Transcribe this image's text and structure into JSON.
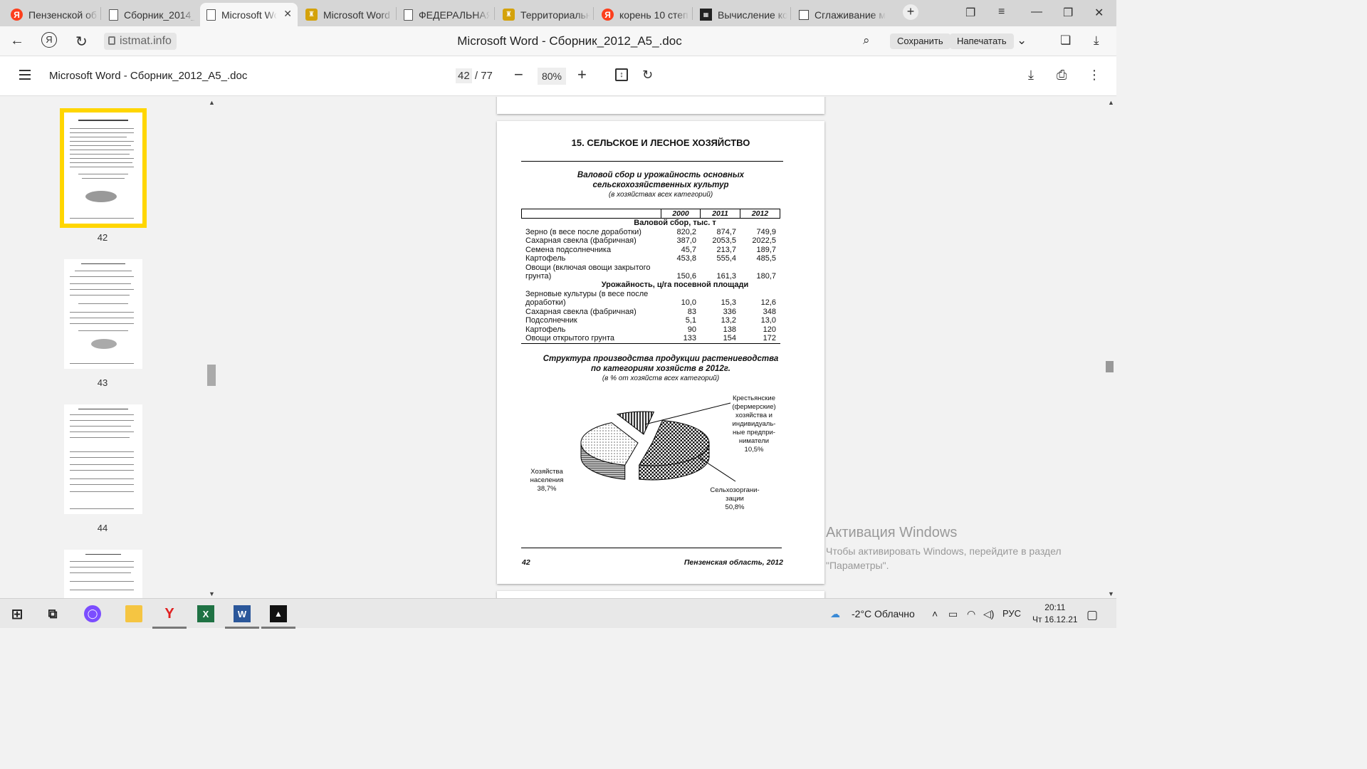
{
  "tabs": [
    {
      "label": "Пензенской об",
      "icon": "yandex-icon"
    },
    {
      "label": "Сборник_2014_",
      "icon": "document-icon"
    },
    {
      "label": "Microsoft Wo",
      "icon": "document-icon",
      "active": true
    },
    {
      "label": "Microsoft Word",
      "icon": "gerb-icon"
    },
    {
      "label": "ФЕДЕРАЛЬНАЯ",
      "icon": "document-icon"
    },
    {
      "label": "Территориальн",
      "icon": "gerb-icon"
    },
    {
      "label": "корень 10 степ",
      "icon": "yandex-icon"
    },
    {
      "label": "Вычисление ко",
      "icon": "nse-icon"
    },
    {
      "label": "Сглаживание м",
      "icon": "page-icon"
    }
  ],
  "addressbar": {
    "domain": "istmat.info",
    "page_title": "Microsoft Word - Сборник_2012_A5_.doc",
    "save_label": "Сохранить",
    "print_label": "Напечатать"
  },
  "pdf_toolbar": {
    "title": "Microsoft Word - Сборник_2012_A5_.doc",
    "current_page": "42",
    "total_pages": "/ 77",
    "zoom": "80%"
  },
  "thumbnails": [
    {
      "number": "42"
    },
    {
      "number": "43"
    },
    {
      "number": "44"
    }
  ],
  "document": {
    "section_title": "15. СЕЛЬСКОЕ И ЛЕСНОЕ ХОЗЯЙСТВО",
    "table_title_line1": "Валовой сбор и урожайность основных",
    "table_title_line2": "сельскохозяйственных культур",
    "table_subtitle": "(в хозяйствах всех категорий)",
    "years": [
      "2000",
      "2011",
      "2012"
    ],
    "section1": "Валовой сбор, тыс. т",
    "section2": "Урожайность, ц/га посевной площади",
    "rows1": [
      {
        "label": "Зерно (в весе после доработки)",
        "v": [
          "820,2",
          "874,7",
          "749,9"
        ]
      },
      {
        "label": "Сахарная свекла (фабричная)",
        "v": [
          "387,0",
          "2053,5",
          "2022,5"
        ]
      },
      {
        "label": "Семена подсолнечника",
        "v": [
          "45,7",
          "213,7",
          "189,7"
        ]
      },
      {
        "label": "Картофель",
        "v": [
          "453,8",
          "555,4",
          "485,5"
        ]
      },
      {
        "label": "Овощи (включая овощи закрытого",
        "v": [
          "",
          "",
          ""
        ]
      },
      {
        "label": "грунта)",
        "v": [
          "150,6",
          "161,3",
          "180,7"
        ]
      }
    ],
    "rows2": [
      {
        "label": "Зерновые культуры (в весе после",
        "v": [
          "",
          "",
          ""
        ]
      },
      {
        "label": "доработки)",
        "v": [
          "10,0",
          "15,3",
          "12,6"
        ]
      },
      {
        "label": "Сахарная свекла (фабричная)",
        "v": [
          "83",
          "336",
          "348"
        ]
      },
      {
        "label": "Подсолнечник",
        "v": [
          "5,1",
          "13,2",
          "13,0"
        ]
      },
      {
        "label": "Картофель",
        "v": [
          "90",
          "138",
          "120"
        ]
      },
      {
        "label": "Овощи открытого грунта",
        "v": [
          "133",
          "154",
          "172"
        ]
      }
    ],
    "chart_title_line1": "Структура производства продукции растениеводства",
    "chart_title_line2": "по категориям хозяйств в 2012г.",
    "chart_subtitle": "(в % от хозяйств всех категорий)",
    "label_farmers": [
      "Крестьянские",
      "(фермерские)",
      "хозяйства и",
      "индивидуаль-",
      "ные предпри-",
      "ниматели",
      "10,5%"
    ],
    "label_households": [
      "Хозяйства",
      "населения",
      "38,7%"
    ],
    "label_agro": [
      "Сельхозоргани-",
      "зации",
      "50,8%"
    ],
    "footer_page": "42",
    "footer_region": "Пензенская область, 2012"
  },
  "chart_data": {
    "type": "pie",
    "title": "Структура производства продукции растениеводства по категориям хозяйств в 2012г.",
    "subtitle": "(в % от хозяйств всех категорий)",
    "categories": [
      "Сельхозорганизации",
      "Хозяйства населения",
      "Крестьянские (фермерские) хозяйства и индивидуальные предприниматели"
    ],
    "values": [
      50.8,
      38.7,
      10.5
    ]
  },
  "watermark": {
    "title": "Активация Windows",
    "line1": "Чтобы активировать Windows, перейдите в раздел",
    "line2": "\"Параметры\"."
  },
  "taskbar": {
    "weather": "-2°C  Облачно",
    "lang": "РУС",
    "time": "20:11",
    "date": "Чт 16.12.21"
  }
}
